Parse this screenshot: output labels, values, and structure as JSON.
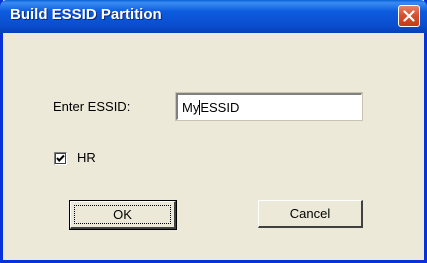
{
  "window": {
    "title": "Build ESSID Partition"
  },
  "form": {
    "essid_label": "Enter ESSID:",
    "essid_value_before_caret": "My",
    "essid_value_after_caret": "ESSID",
    "hr_label": "HR",
    "hr_checked": true
  },
  "buttons": {
    "ok_label": "OK",
    "cancel_label": "Cancel"
  },
  "icons": {
    "close": "close-icon",
    "check": "checkmark-icon"
  },
  "colors": {
    "titlebar": "#0a4fd0",
    "window_border": "#0831d9",
    "dialog_background": "#ece9d8",
    "close_button": "#d9502f"
  }
}
